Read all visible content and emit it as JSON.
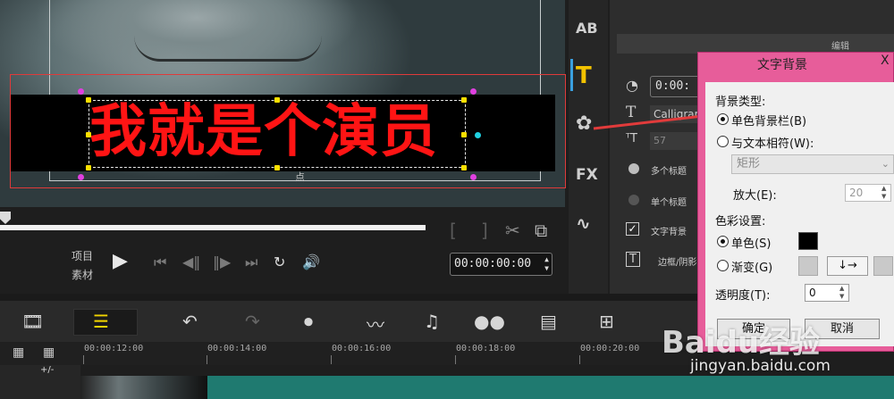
{
  "preview": {
    "title_text": "我就是个演员",
    "safe_area_label": "点"
  },
  "transport": {
    "project_label": "项目",
    "clip_label": "素材",
    "timecode": "00:00:00:00",
    "icons": [
      "play-icon",
      "go-start-icon",
      "prev-frame-icon",
      "next-frame-icon",
      "go-end-icon",
      "repeat-icon",
      "volume-icon"
    ]
  },
  "tool_strip": {
    "items": [
      "AB",
      "T",
      "FX"
    ]
  },
  "options_panel": {
    "tab_label": "编辑",
    "time_value": "0:00:",
    "font_value": "Calligrar",
    "size_value": "57",
    "multi_title_label": "多个标题",
    "single_title_label": "单个标题",
    "text_bg_label": "文字背景",
    "border_shadow_label": "边框/阴影"
  },
  "dialog": {
    "title": "文字背景",
    "close_label": "X",
    "bg_type_label": "背景类型:",
    "option_solid_bar": "单色背景栏(B)",
    "option_fit_text": "与文本相符(W):",
    "shape_value": "矩形",
    "zoom_label": "放大(E):",
    "zoom_value": "20",
    "color_settings_label": "色彩设置:",
    "option_single_color": "单色(S)",
    "option_gradient": "渐变(G)",
    "gradient_direction": "↓→",
    "opacity_label": "透明度(T):",
    "opacity_value": "0",
    "ok_label": "确定",
    "cancel_label": "取消",
    "selected_bg_type": "solid_bar",
    "selected_color_mode": "single",
    "swatch_color": "#000000"
  },
  "timeline": {
    "add_remove_label": "+/-",
    "ticks": [
      "00:00:12:00",
      "00:00:14:00",
      "00:00:16:00",
      "00:00:18:00",
      "00:00:20:00"
    ]
  },
  "watermark": {
    "logo": "Baidu经验",
    "url": "jingyan.baidu.com"
  },
  "colors": {
    "title_red": "#ff1414",
    "dialog_pink": "#e75d9a",
    "track_teal": "#1f7a70",
    "accent_yellow": "#ffe000"
  }
}
